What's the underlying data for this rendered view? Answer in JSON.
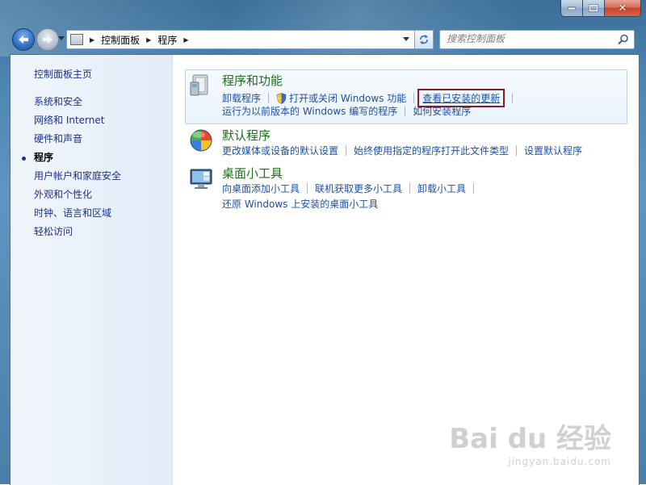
{
  "window": {
    "minimize_glyph": "—",
    "maximize_glyph": "□",
    "close_glyph": "✕"
  },
  "address_bar": {
    "breadcrumbs": [
      "控制面板",
      "程序"
    ]
  },
  "search": {
    "placeholder": "搜索控制面板"
  },
  "sidebar": {
    "items": [
      {
        "label": "控制面板主页",
        "active": false
      },
      {
        "label": "系统和安全",
        "active": false
      },
      {
        "label": "网络和 Internet",
        "active": false
      },
      {
        "label": "硬件和声音",
        "active": false
      },
      {
        "label": "程序",
        "active": true
      },
      {
        "label": "用户帐户和家庭安全",
        "active": false
      },
      {
        "label": "外观和个性化",
        "active": false
      },
      {
        "label": "时钟、语言和区域",
        "active": false
      },
      {
        "label": "轻松访问",
        "active": false
      }
    ]
  },
  "categories": [
    {
      "title": "程序和功能",
      "icon": "programs-features-icon",
      "row1": [
        "卸载程序",
        "打开或关闭 Windows 功能",
        "查看已安装的更新"
      ],
      "row2": [
        "运行为以前版本的 Windows 编写的程序",
        "如何安装程序"
      ]
    },
    {
      "title": "默认程序",
      "icon": "default-programs-icon",
      "row1": [
        "更改媒体或设备的默认设置",
        "始终使用指定的程序打开此文件类型",
        "设置默认程序"
      ]
    },
    {
      "title": "桌面小工具",
      "icon": "desktop-gadgets-icon",
      "row1": [
        "向桌面添加小工具",
        "联机获取更多小工具",
        "卸载小工具"
      ],
      "row2": [
        "还原 Windows 上安装的桌面小工具"
      ]
    }
  ],
  "highlight_color": "#8b1a28",
  "watermark": {
    "main": "Bai du 经验",
    "sub": "jingyan.baidu.com"
  }
}
